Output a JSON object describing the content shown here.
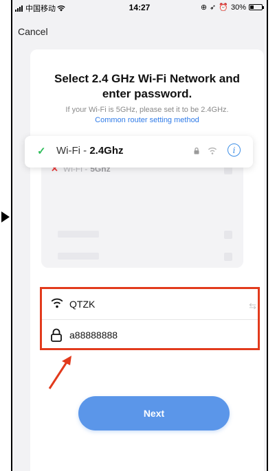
{
  "status_bar": {
    "carrier": "中国移动",
    "time": "14:27",
    "battery": "30%",
    "battery_level": 0.3
  },
  "nav": {
    "cancel_label": "Cancel"
  },
  "page": {
    "title": "Select 2.4 GHz Wi-Fi Network and enter password.",
    "hint": "If your Wi-Fi is 5GHz, please set it to be 2.4GHz.",
    "link": "Common router setting method"
  },
  "illustration": {
    "wifi_5g_prefix": "Wi-Fi - ",
    "wifi_5g_band": "5Ghz",
    "wifi_24_prefix": "Wi-Fi - ",
    "wifi_24_band": "2.4Ghz"
  },
  "form": {
    "ssid": "QTZK",
    "password": "a88888888"
  },
  "actions": {
    "next_label": "Next"
  },
  "colors": {
    "accent": "#5b96e9",
    "link": "#2f7be8",
    "highlight_border": "#e23a1c",
    "check": "#2ebd59",
    "cross": "#e83a3a"
  }
}
